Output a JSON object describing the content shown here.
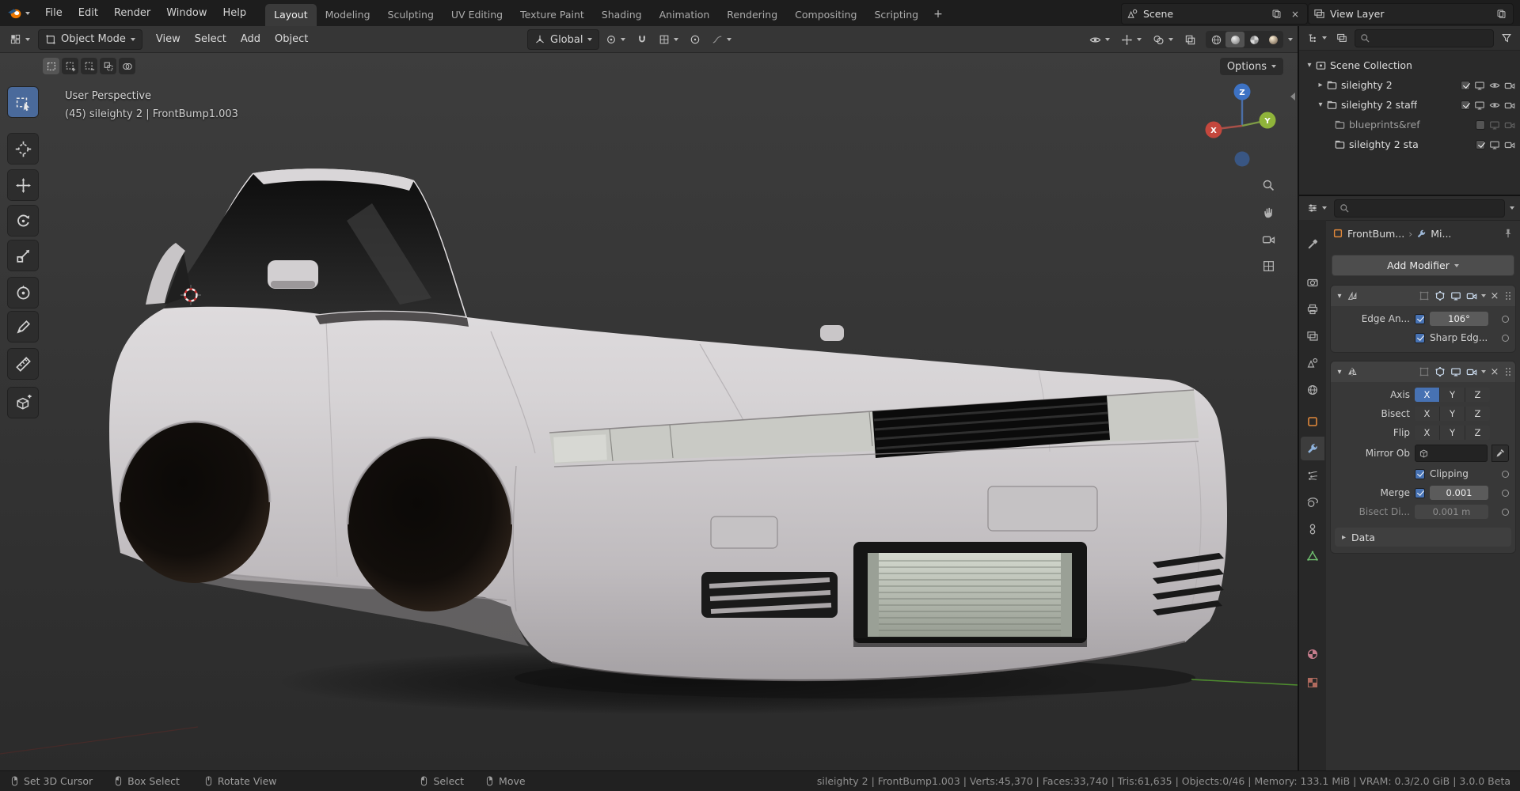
{
  "colors": {
    "accent": "#4772b3",
    "axis_x": "#c4473d",
    "axis_y": "#8fb43a",
    "axis_z": "#3d72c4",
    "car_body": "#d6d3d5"
  },
  "icons": {
    "collapsed": "▸",
    "expanded": "▾",
    "close": "×",
    "add": "+",
    "breadcrumb_sep": "›"
  },
  "topbar": {
    "menus": [
      {
        "label": "File"
      },
      {
        "label": "Edit"
      },
      {
        "label": "Render"
      },
      {
        "label": "Window"
      },
      {
        "label": "Help"
      }
    ],
    "workspaces": [
      {
        "label": "Layout",
        "active": true
      },
      {
        "label": "Modeling"
      },
      {
        "label": "Sculpting"
      },
      {
        "label": "UV Editing"
      },
      {
        "label": "Texture Paint"
      },
      {
        "label": "Shading"
      },
      {
        "label": "Animation"
      },
      {
        "label": "Rendering"
      },
      {
        "label": "Compositing"
      },
      {
        "label": "Scripting"
      }
    ],
    "add_workspace_label": "+",
    "scene_name": "Scene",
    "view_layer_name": "View Layer"
  },
  "viewport_header": {
    "mode": "Object Mode",
    "menus": [
      "View",
      "Select",
      "Add",
      "Object"
    ],
    "orientation": "Global"
  },
  "tool_settings": {
    "options_label": "Options"
  },
  "viewport": {
    "view_label": "User Perspective",
    "active_object_label": "(45) sileighty 2 | FrontBump1.003",
    "gizmo": {
      "x": "X",
      "y": "Y",
      "z": "Z"
    }
  },
  "outliner": {
    "rows": [
      {
        "label": "Scene Collection"
      },
      {
        "label": "sileighty 2"
      },
      {
        "label": "sileighty 2 staff"
      },
      {
        "label": "blueprints&ref"
      },
      {
        "label": "sileighty 2 sta"
      }
    ]
  },
  "properties": {
    "breadcrumb": {
      "object": "FrontBum...",
      "modifier": "Mi..."
    },
    "add_modifier_label": "Add Modifier",
    "edge_split": {
      "edge_angle_label": "Edge An...",
      "edge_angle_value": "106°",
      "sharp_edges_label": "Sharp Edg..."
    },
    "mirror": {
      "axis_label": "Axis",
      "bisect_label": "Bisect",
      "flip_label": "Flip",
      "axis_x": "X",
      "axis_y": "Y",
      "axis_z": "Z",
      "mirror_object_label": "Mirror Ob",
      "clipping_label": "Clipping",
      "merge_label": "Merge",
      "merge_value": "0.001",
      "bisect_distance_label": "Bisect Di...",
      "bisect_distance_value": "0.001 m",
      "data_label": "Data"
    }
  },
  "statusbar": {
    "hints": [
      {
        "label": "Set 3D Cursor"
      },
      {
        "label": "Box Select"
      },
      {
        "label": "Rotate View"
      },
      {
        "label": "Select"
      },
      {
        "label": "Move"
      }
    ],
    "info": "sileighty 2 | FrontBump1.003 | Verts:45,370 | Faces:33,740 | Tris:61,635 | Objects:0/46 | Memory: 133.1 MiB | VRAM: 0.3/2.0 GiB | 3.0.0 Beta"
  }
}
